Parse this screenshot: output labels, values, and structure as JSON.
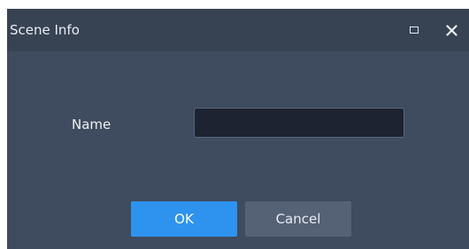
{
  "dialog": {
    "title": "Scene Info",
    "controls": {
      "maximize_icon": "maximize-icon",
      "close_icon": "close-icon"
    },
    "form": {
      "name_label": "Name",
      "name_value": "",
      "name_placeholder": ""
    },
    "buttons": {
      "ok_label": "OK",
      "cancel_label": "Cancel"
    }
  },
  "colors": {
    "titlebar": "#374253",
    "body": "#3f4b5e",
    "input_background": "#1d2330",
    "ok_button": "#2e93ee",
    "cancel_button": "#556175"
  }
}
